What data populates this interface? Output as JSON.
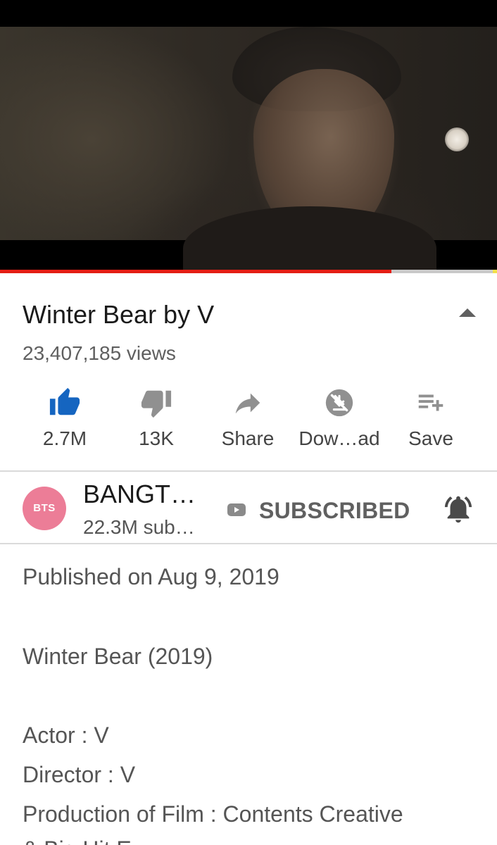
{
  "player": {
    "progress_fraction": 0.787,
    "colors": {
      "progress": "#e41e14",
      "track": "#c9c9c9",
      "buffer": "#f4e04a"
    }
  },
  "video": {
    "title": "Winter Bear by V",
    "views": "23,407,185 views"
  },
  "actions": [
    {
      "icon": "thumbs-up-icon",
      "label": "2.7M",
      "active": true,
      "color": "#1565c0"
    },
    {
      "icon": "thumbs-down-icon",
      "label": "13K",
      "color": "#909090"
    },
    {
      "icon": "share-icon",
      "label": "Share",
      "color": "#909090"
    },
    {
      "icon": "download-disabled-icon",
      "label": "Dow…ad",
      "color": "#909090"
    },
    {
      "icon": "add-to-playlist-icon",
      "label": "Save",
      "color": "#909090"
    }
  ],
  "channel": {
    "avatar_text": "BTS",
    "avatar_color": "#ec7d97",
    "name": "BANGT…",
    "subscribers": "22.3M sub…",
    "subscribe_label": "SUBSCRIBED"
  },
  "description": {
    "published": "Published on Aug 9, 2019",
    "lines": [
      "Winter Bear (2019)",
      "Actor : V",
      "Director : V",
      "Production of Film : Contents Creative"
    ],
    "cutoff_line": "& Big Hit E…"
  }
}
